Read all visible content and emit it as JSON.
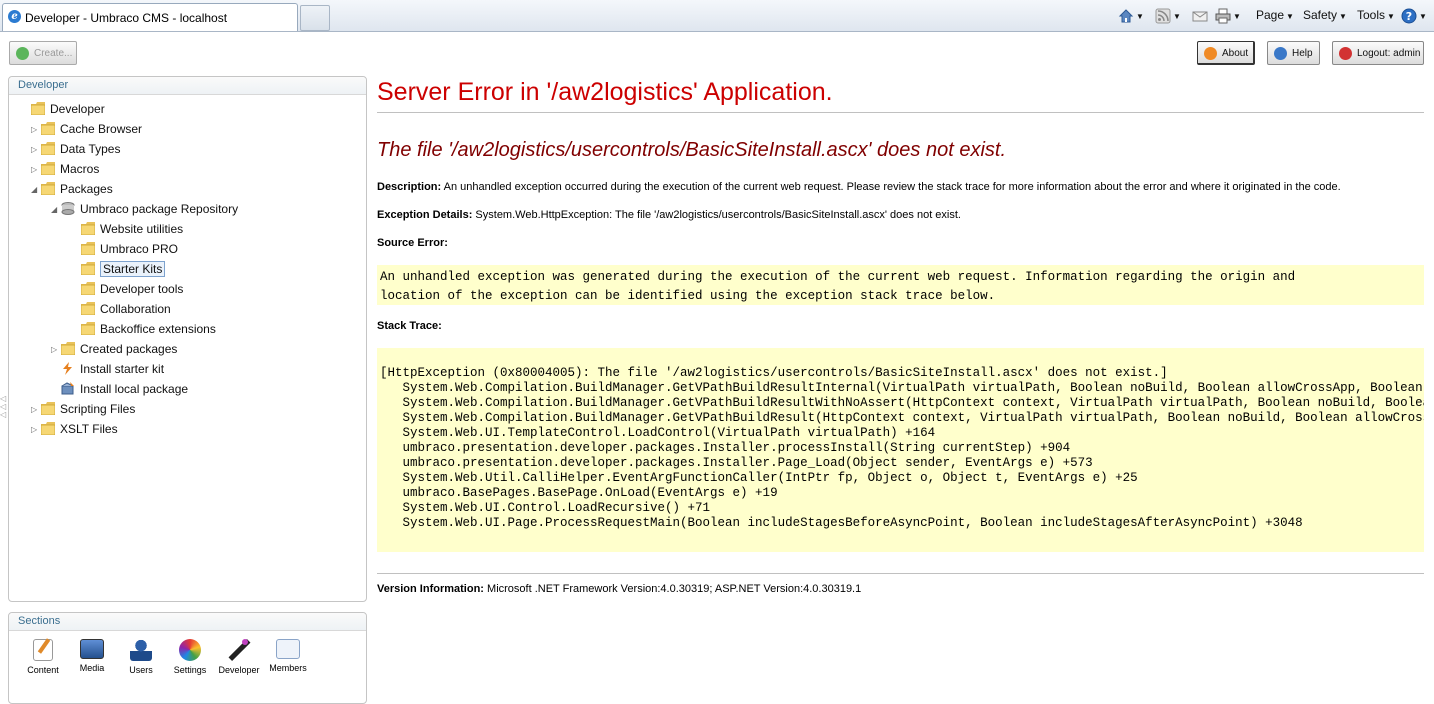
{
  "browser": {
    "tab_title": "Developer - Umbraco CMS - localhost",
    "commands": {
      "page": "Page",
      "safety": "Safety",
      "tools": "Tools"
    }
  },
  "toolbar": {
    "create_label": "Create...",
    "about_label": "About",
    "help_label": "Help",
    "logout_label": "Logout: admin"
  },
  "tree": {
    "header": "Developer",
    "items": [
      {
        "label": "Developer"
      },
      {
        "label": "Cache Browser"
      },
      {
        "label": "Data Types"
      },
      {
        "label": "Macros"
      },
      {
        "label": "Packages"
      },
      {
        "label": "Umbraco package Repository"
      },
      {
        "label": "Website utilities"
      },
      {
        "label": "Umbraco PRO"
      },
      {
        "label": "Starter Kits"
      },
      {
        "label": "Developer tools"
      },
      {
        "label": "Collaboration"
      },
      {
        "label": "Backoffice extensions"
      },
      {
        "label": "Created packages"
      },
      {
        "label": "Install starter kit"
      },
      {
        "label": "Install local package"
      },
      {
        "label": "Scripting Files"
      },
      {
        "label": "XSLT Files"
      }
    ]
  },
  "sections": {
    "header": "Sections",
    "items": [
      {
        "label": "Content"
      },
      {
        "label": "Media"
      },
      {
        "label": "Users"
      },
      {
        "label": "Settings"
      },
      {
        "label": "Developer"
      },
      {
        "label": "Members"
      }
    ]
  },
  "error": {
    "title": "Server Error in '/aw2logistics' Application.",
    "subtitle": "The file '/aw2logistics/usercontrols/BasicSiteInstall.ascx' does not exist.",
    "description_label": "Description:",
    "description_text": "An unhandled exception occurred during the execution of the current web request. Please review the stack trace for more information about the error and where it originated in the code.",
    "exception_label": "Exception Details:",
    "exception_text": "System.Web.HttpException: The file '/aw2logistics/usercontrols/BasicSiteInstall.ascx' does not exist.",
    "source_error_label": "Source Error:",
    "source_error_lines": [
      "An unhandled exception was generated during the execution of the current web request. Information regarding the origin and",
      "location of the exception can be identified using the exception stack trace below."
    ],
    "stack_trace_label": "Stack Trace:",
    "stack_trace_lines": [
      "[HttpException (0x80004005): The file '/aw2logistics/usercontrols/BasicSiteInstall.ascx' does not exist.]",
      "   System.Web.Compilation.BuildManager.GetVPathBuildResultInternal(VirtualPath virtualPath, Boolean noBuild, Boolean allowCrossApp, Boolean allowBuil",
      "   System.Web.Compilation.BuildManager.GetVPathBuildResultWithNoAssert(HttpContext context, VirtualPath virtualPath, Boolean noBuild, Boolean allowCr",
      "   System.Web.Compilation.BuildManager.GetVPathBuildResult(HttpContext context, VirtualPath virtualPath, Boolean noBuild, Boolean allowCrossApp, Bool",
      "   System.Web.UI.TemplateControl.LoadControl(VirtualPath virtualPath) +164",
      "   umbraco.presentation.developer.packages.Installer.processInstall(String currentStep) +904",
      "   umbraco.presentation.developer.packages.Installer.Page_Load(Object sender, EventArgs e) +573",
      "   System.Web.Util.CalliHelper.EventArgFunctionCaller(IntPtr fp, Object o, Object t, EventArgs e) +25",
      "   umbraco.BasePages.BasePage.OnLoad(EventArgs e) +19",
      "   System.Web.UI.Control.LoadRecursive() +71",
      "   System.Web.UI.Page.ProcessRequestMain(Boolean includeStagesBeforeAsyncPoint, Boolean includeStagesAfterAsyncPoint) +3048"
    ],
    "version_label": "Version Information:",
    "version_text": "Microsoft .NET Framework Version:4.0.30319; ASP.NET Version:4.0.30319.1"
  }
}
